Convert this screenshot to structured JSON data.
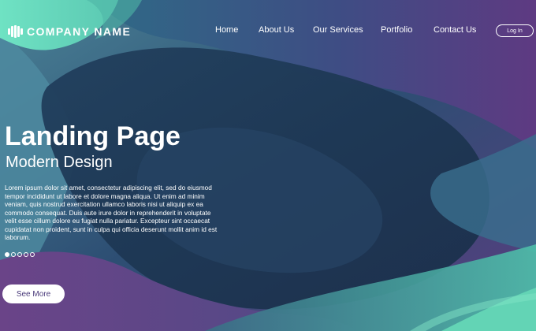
{
  "brand": {
    "logo_icon": "vertical-bars-logo-icon",
    "name": "COMPANY NAME"
  },
  "nav": {
    "items": [
      {
        "label": "Home"
      },
      {
        "label": "About Us"
      },
      {
        "label": "Our Services"
      },
      {
        "label": "Portfolio"
      },
      {
        "label": "Contact Us"
      }
    ],
    "login_label": "Log In"
  },
  "hero": {
    "title": "Landing Page",
    "subtitle": "Modern Design",
    "body": "Lorem ipsum dolor sit amet, consectetur adipiscing elit, sed do eiusmod tempor incididunt ut labore et dolore magna aliqua. Ut enim ad minim veniam, quis nostrud exercitation ullamco laboris nisi ut aliquip ex ea commodo consequat. Duis aute irure dolor in reprehenderit in voluptate velit esse cillum dolore eu fugiat nulla pariatur. Excepteur sint occaecat cupidatat non proident, sunt in culpa qui officia deserunt mollit anim id est laborum.",
    "slides": {
      "count": 5,
      "active": 1
    },
    "cta_label": "See More"
  },
  "colors": {
    "teal": "#5fd6b4",
    "dark_navy": "#1f3550",
    "purple": "#5a3d7e",
    "button_text": "#4a3a7a"
  }
}
